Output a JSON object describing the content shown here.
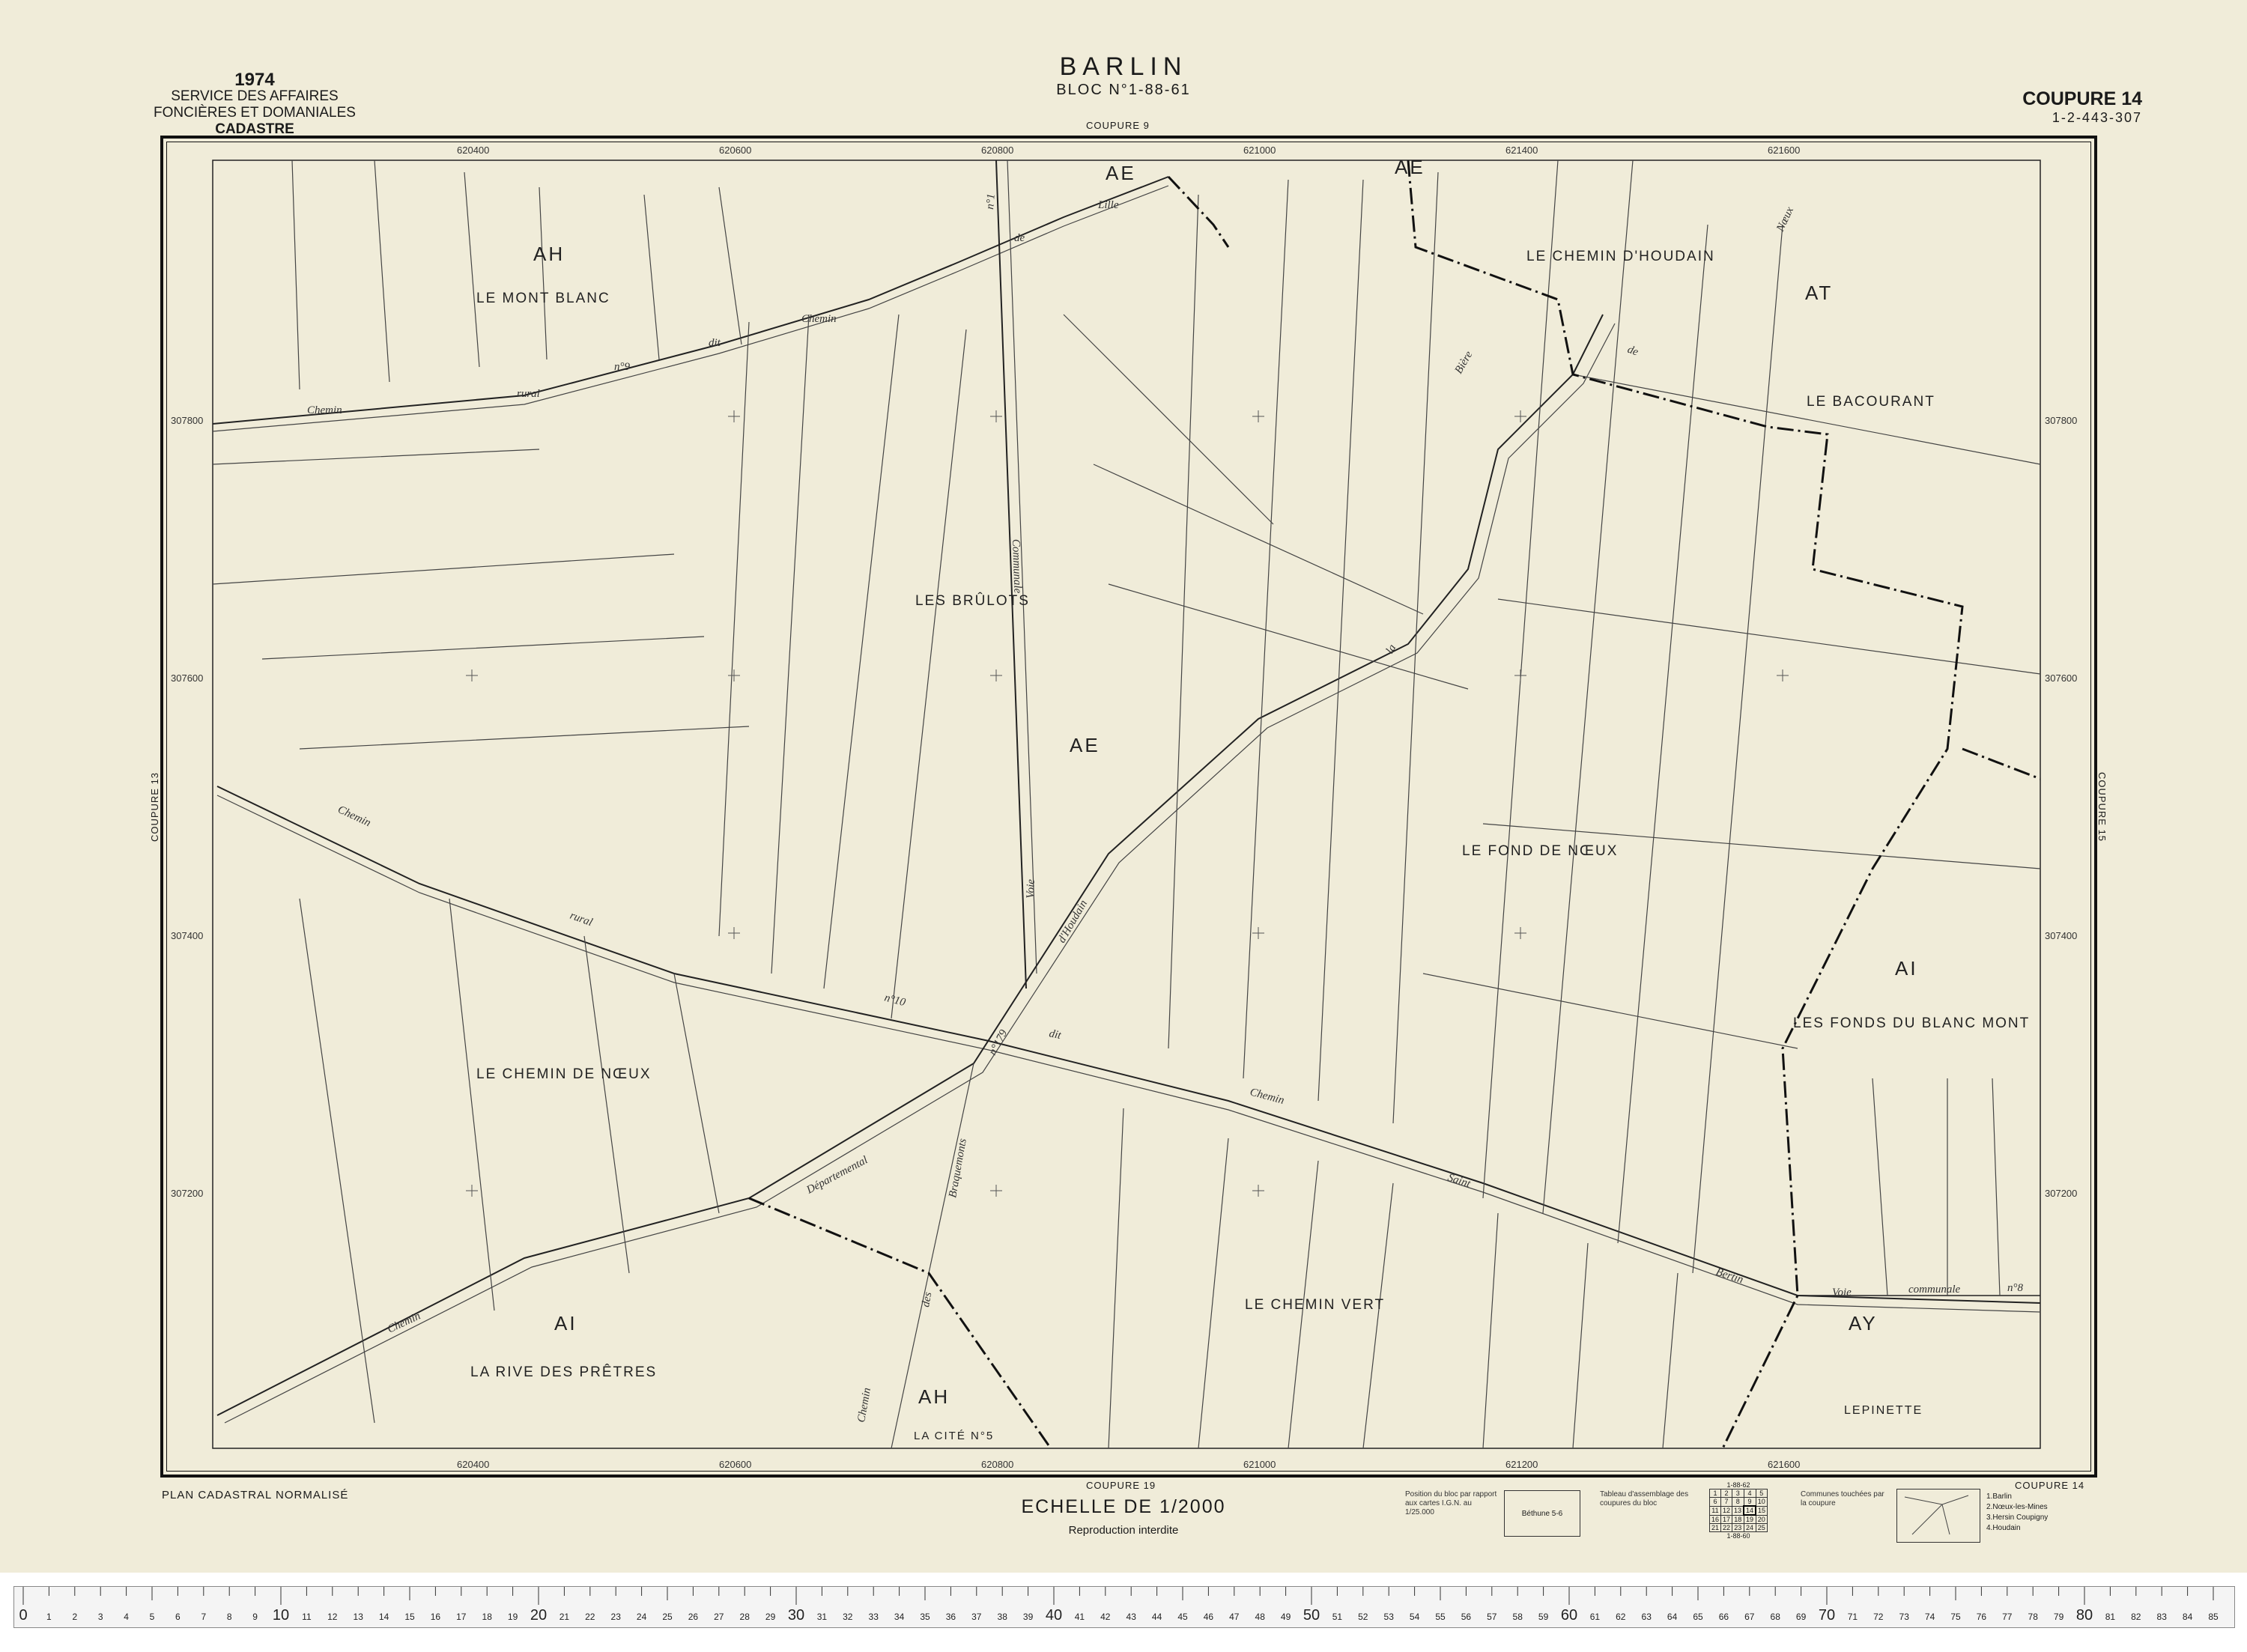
{
  "header": {
    "year": "1974",
    "service_line1": "SERVICE DES AFFAIRES",
    "service_line2": "FONCIÈRES ET DOMANIALES",
    "cadastre": "CADASTRE",
    "town": "BARLIN",
    "bloc": "BLOC N°1-88-61",
    "coupure": "COUPURE 14",
    "reference": "1-2-443-307"
  },
  "neighbors": {
    "top": "COUPURE 9",
    "bottom": "COUPURE 19",
    "left": "COUPURE 13",
    "right": "COUPURE 15",
    "bottom_right": "COUPURE 14"
  },
  "grid_labels": {
    "x": [
      "620400",
      "620600",
      "620800",
      "621000",
      "621400",
      "621600"
    ],
    "x_bottom": [
      "620400",
      "620600",
      "620800",
      "621000",
      "621200",
      "621600"
    ],
    "y": [
      "307800",
      "307600",
      "307400",
      "307200"
    ]
  },
  "sections": [
    "AH",
    "AE",
    "AE",
    "AE",
    "AT",
    "AI",
    "AI",
    "AH",
    "AY"
  ],
  "localities": [
    "LE MONT BLANC",
    "LES BRÛLOTS",
    "LE CHEMIN D'HOUDAIN",
    "LE BACOURANT",
    "LE FOND DE NŒUX",
    "LES FONDS DU BLANC MONT",
    "LE CHEMIN DE NŒUX",
    "LE CHEMIN VERT",
    "LA RIVE DES PRÊTRES",
    "LA CITÉ N°5",
    "LEPINETTE"
  ],
  "roads": [
    "Chemin",
    "rural",
    "n°9",
    "dit",
    "Chemin",
    "de",
    "Lille",
    "Voie",
    "Communale",
    "n°1",
    "la",
    "Bière",
    "de",
    "Nœux",
    "Chemin",
    "rural",
    "n°10",
    "dit",
    "Chemin",
    "Saint",
    "Bertin",
    "Départemental",
    "Chemin",
    "n°179",
    "d'Houdain",
    "des",
    "Braquemonts",
    "Voie",
    "communale",
    "n°8",
    "Chemin"
  ],
  "footer": {
    "plan": "PLAN CADASTRAL NORMALISÉ",
    "scale": "ECHELLE DE 1/2000",
    "reproduction": "Reproduction interdite",
    "position_note": "Position du bloc par rapport aux cartes I.G.N. au 1/25.000",
    "position_ref": "Béthune 5-6",
    "assemblage_note": "Tableau d'assemblage des coupures du bloc",
    "assemblage_top": "1-88-62",
    "assemblage_bottom": "1-88-60",
    "assemblage_grid": [
      [
        "1",
        "2",
        "3",
        "4",
        "5"
      ],
      [
        "6",
        "7",
        "8",
        "9",
        "10"
      ],
      [
        "11",
        "12",
        "13",
        "14",
        "15"
      ],
      [
        "16",
        "17",
        "18",
        "19",
        "20"
      ],
      [
        "21",
        "22",
        "23",
        "24",
        "25"
      ]
    ],
    "communes_note": "Communes touchées par la coupure",
    "communes": [
      "1.Barlin",
      "2.Nœux-les-Mines",
      "3.Hersin Coupigny",
      "4.Houdain"
    ]
  },
  "ruler": {
    "marks": [
      "0",
      "1",
      "2",
      "3",
      "4",
      "5",
      "6",
      "7",
      "8",
      "9",
      "10",
      "11",
      "12",
      "13",
      "14",
      "15",
      "16",
      "17",
      "18",
      "19",
      "20",
      "21",
      "22",
      "23",
      "24",
      "25",
      "26",
      "27",
      "28",
      "29",
      "30",
      "31",
      "32",
      "33",
      "34",
      "35",
      "36",
      "37",
      "38",
      "39",
      "40",
      "41",
      "42",
      "43",
      "44",
      "45",
      "46",
      "47",
      "48",
      "49",
      "50",
      "51",
      "52",
      "53",
      "54",
      "55",
      "56",
      "57",
      "58",
      "59",
      "60",
      "61",
      "62",
      "63",
      "64",
      "65",
      "66",
      "67",
      "68",
      "69",
      "70",
      "71",
      "72",
      "73",
      "74",
      "75",
      "76",
      "77",
      "78",
      "79",
      "80",
      "81",
      "82",
      "83",
      "84",
      "85"
    ]
  },
  "colors": {
    "paper": "#f0ecd9",
    "ink": "#1a1a1a",
    "ruler": "#f4f4f4"
  }
}
